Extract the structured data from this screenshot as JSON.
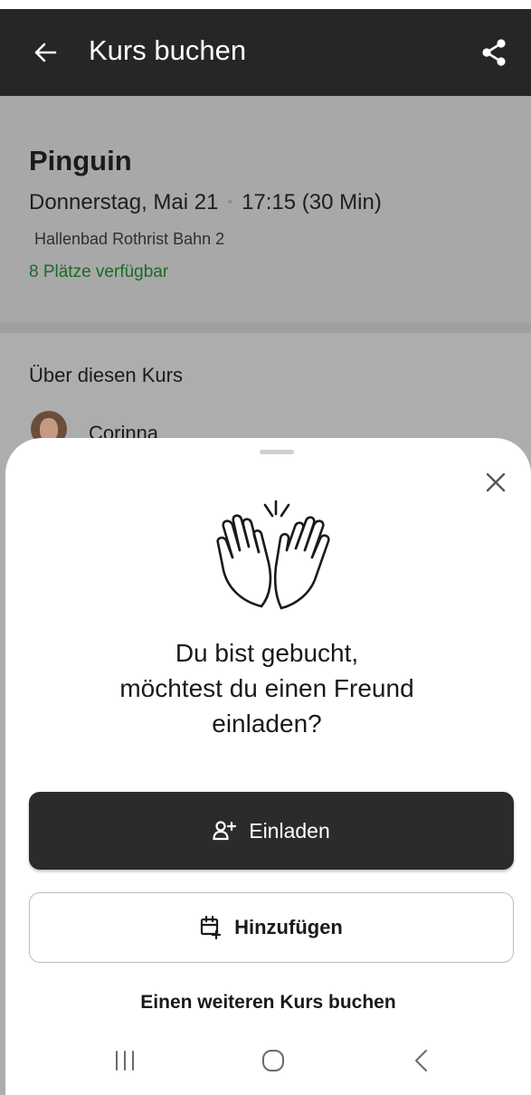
{
  "app_bar": {
    "title": "Kurs buchen",
    "back_icon": "arrow-left-icon",
    "share_icon": "share-icon",
    "background": "#262626"
  },
  "course": {
    "name": "Pinguin",
    "date": "Donnerstag, Mai 21",
    "time": "17:15 (30 Min)",
    "location": "Hallenbad Rothrist Bahn 2",
    "availability": "8 Plätze verfügbar",
    "availability_color": "#1b6a25"
  },
  "about": {
    "title": "Über diesen Kurs",
    "instructor_name": "Corinna"
  },
  "sheet": {
    "close_icon": "close-icon",
    "illustration_icon": "high-five-icon",
    "headline_lines": [
      "Du bist gebucht,",
      "möchtest du einen Freund",
      "einladen?"
    ],
    "invite_label": "Einladen",
    "invite_icon": "add-person-icon",
    "add_label": "Hinzufügen",
    "add_icon": "calendar-add-icon",
    "more_label": "Einen weiteren Kurs buchen"
  },
  "system_nav": {
    "recents_icon": "recents-icon",
    "home_icon": "home-icon",
    "back_icon": "system-back-icon"
  }
}
